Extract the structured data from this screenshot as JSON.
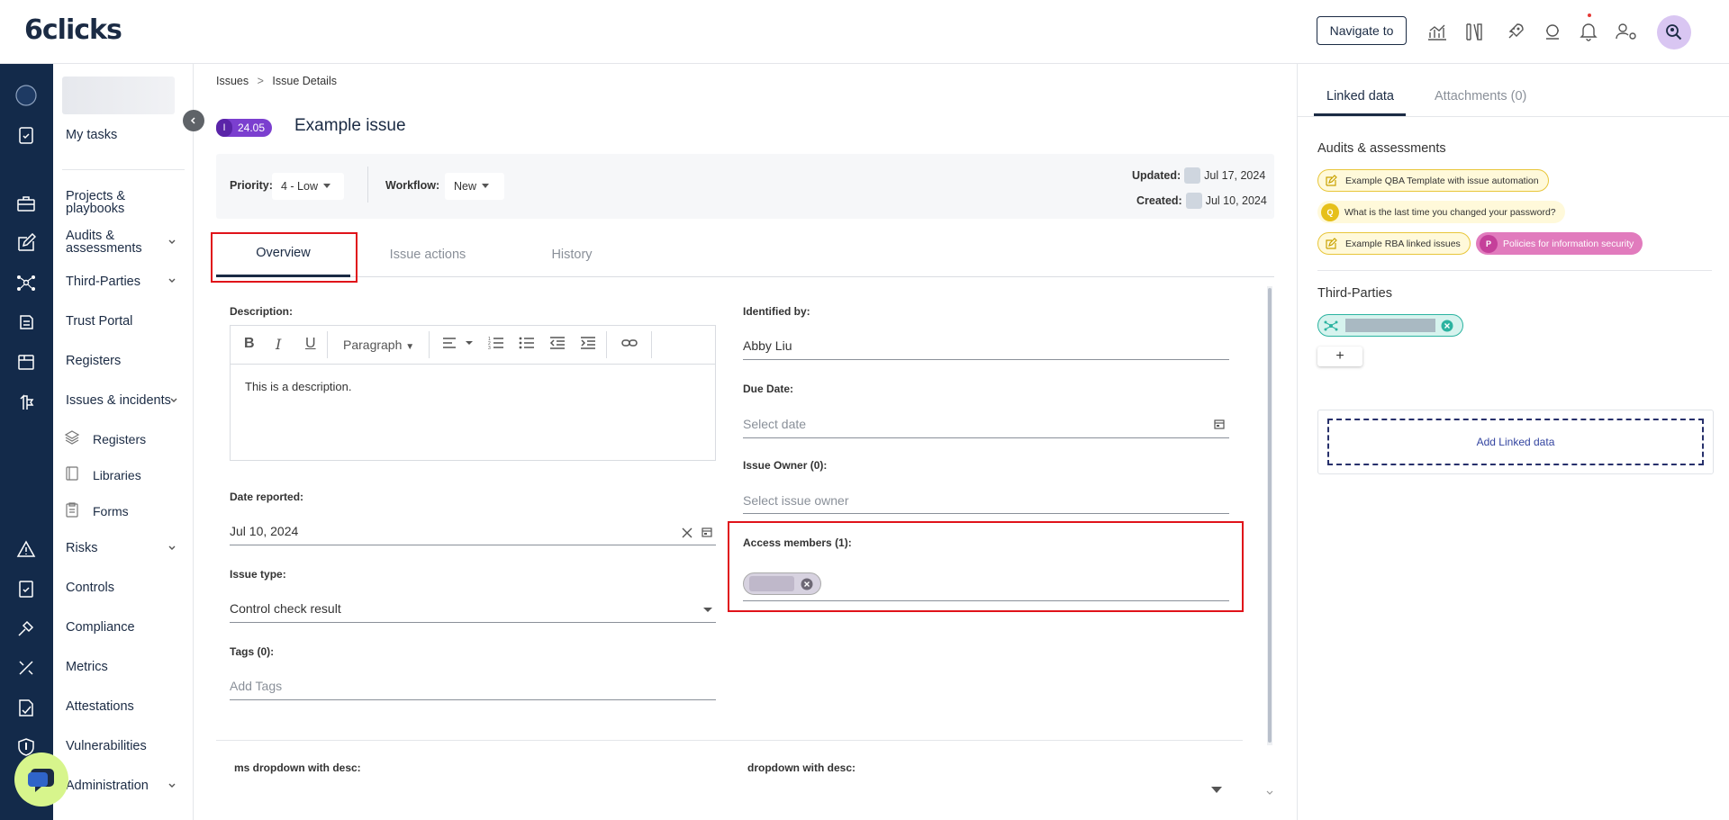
{
  "app": {
    "logo": "6clicks",
    "navigate_label": "Navigate to"
  },
  "top_icons": [
    "dashboard-chart-icon",
    "library-icon",
    "rocket-icon",
    "support-icon",
    "bell-icon",
    "user-settings-icon",
    "user-search-icon"
  ],
  "nav": {
    "my_tasks": "My tasks",
    "items": [
      {
        "label": "Projects & playbooks"
      },
      {
        "label": "Audits & assessments",
        "expandable": true
      },
      {
        "label": "Third-Parties",
        "expandable": true
      },
      {
        "label": "Trust Portal"
      },
      {
        "label": "Registers"
      },
      {
        "label": "Issues & incidents",
        "expandable": true
      },
      {
        "label": "Risks",
        "expandable": true
      },
      {
        "label": "Controls"
      },
      {
        "label": "Compliance"
      },
      {
        "label": "Metrics"
      },
      {
        "label": "Attestations"
      },
      {
        "label": "Vulnerabilities"
      },
      {
        "label": "Administration",
        "expandable": true
      }
    ],
    "sub_items": [
      {
        "label": "Registers",
        "icon": "layers-icon"
      },
      {
        "label": "Libraries",
        "icon": "book-icon"
      },
      {
        "label": "Forms",
        "icon": "clipboard-icon"
      }
    ]
  },
  "breadcrumb": {
    "root": "Issues",
    "separator": ">",
    "current": "Issue Details"
  },
  "issue": {
    "badge_letter": "I",
    "badge_number": "24.05",
    "title": "Example issue",
    "priority_label": "Priority:",
    "priority_value": "4 - Low",
    "workflow_label": "Workflow:",
    "workflow_value": "New",
    "updated_label": "Updated:",
    "updated_value": "Jul 17, 2024",
    "created_label": "Created:",
    "created_value": "Jul 10, 2024"
  },
  "tabs": {
    "overview": "Overview",
    "actions": "Issue actions",
    "history": "History"
  },
  "form": {
    "description_label": "Description:",
    "toolbar": {
      "paragraph": "Paragraph"
    },
    "description_value": "This is a description.",
    "date_reported_label": "Date reported:",
    "date_reported_value": "Jul 10, 2024",
    "issue_type_label": "Issue type:",
    "issue_type_value": "Control check result",
    "tags_label": "Tags (0):",
    "tags_placeholder": "Add Tags",
    "identified_label": "Identified by:",
    "identified_value": "Abby Liu",
    "due_label": "Due Date:",
    "due_placeholder": "Select date",
    "owner_label": "Issue Owner (0):",
    "owner_placeholder": "Select issue owner",
    "members_label": "Access members (1):",
    "ms_dropdown_label": "ms dropdown with desc:",
    "dropdown_label": "dropdown with desc:"
  },
  "right": {
    "tab_linked": "Linked data",
    "tab_attachments": "Attachments (0)",
    "audits_title": "Audits & assessments",
    "audits": [
      {
        "label": "Example QBA Template with issue automation",
        "icon": "edit-icon",
        "style": "yellow"
      },
      {
        "label": "What is the last time you changed your password?",
        "icon_letter": "Q",
        "style": "yellow-solid"
      },
      {
        "label": "Example RBA linked issues",
        "icon": "edit-icon",
        "style": "yellow"
      },
      {
        "label": "Policies for information security",
        "icon_letter": "P",
        "style": "pink"
      }
    ],
    "third_parties_title": "Third-Parties",
    "add_symbol": "+",
    "add_linked": "Add Linked data"
  },
  "colors": {
    "rail": "#132a4a",
    "accent": "#1b2b44",
    "badge": "#7b3fcf",
    "highlight": "#e0131a",
    "chat": "#d7f58c"
  }
}
